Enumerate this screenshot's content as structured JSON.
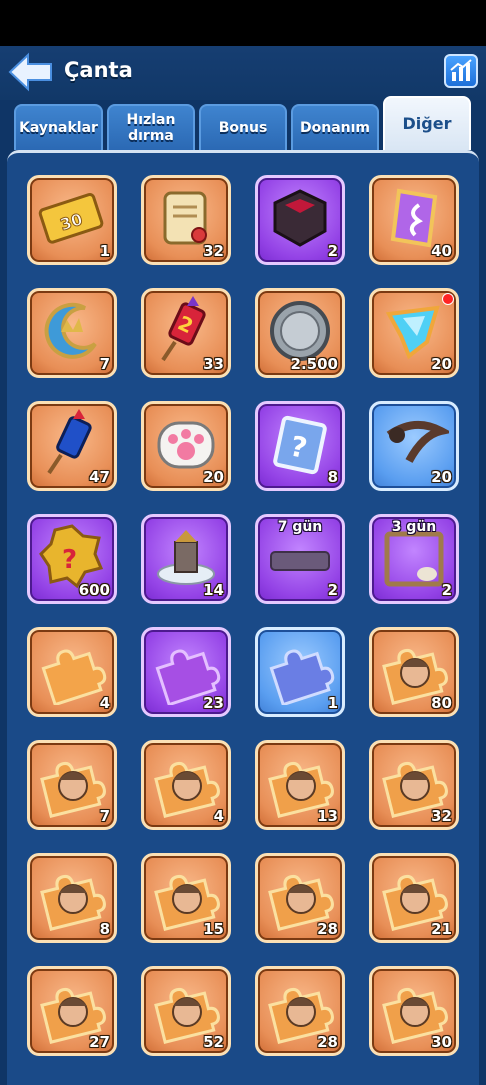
{
  "header": {
    "title": "Çanta"
  },
  "tabs": [
    {
      "label": "Kaynaklar",
      "active": false
    },
    {
      "label": "Hızlan dırma",
      "active": false
    },
    {
      "label": "Bonus",
      "active": false
    },
    {
      "label": "Donanım",
      "active": false
    },
    {
      "label": "Diğer",
      "active": true
    }
  ],
  "items": [
    {
      "icon": "ticket-30-icon",
      "count": "1",
      "bg": "orange"
    },
    {
      "icon": "scroll-icon",
      "count": "32",
      "bg": "orange"
    },
    {
      "icon": "dark-cube-icon",
      "count": "2",
      "bg": "purple"
    },
    {
      "icon": "purple-rune-icon",
      "count": "40",
      "bg": "orange"
    },
    {
      "icon": "crescent-moon-icon",
      "count": "7",
      "bg": "orange"
    },
    {
      "icon": "firework-2-icon",
      "count": "33",
      "bg": "orange"
    },
    {
      "icon": "silver-coin-icon",
      "count": "2.500",
      "bg": "orange"
    },
    {
      "icon": "blue-crystal-icon",
      "count": "20",
      "bg": "orange"
    },
    {
      "icon": "firework-blue-icon",
      "count": "47",
      "bg": "orange"
    },
    {
      "icon": "paw-icon",
      "count": "20",
      "bg": "orange"
    },
    {
      "icon": "mystery-card-icon",
      "count": "8",
      "bg": "purple"
    },
    {
      "icon": "scythe-icon",
      "count": "20",
      "bg": "blue"
    },
    {
      "icon": "mystery-badge-icon",
      "count": "600",
      "bg": "purple"
    },
    {
      "icon": "castle-skin-icon",
      "count": "14",
      "bg": "purple"
    },
    {
      "icon": "nameplate-icon",
      "count": "2",
      "bg": "purple",
      "days": "7 gün"
    },
    {
      "icon": "skull-frame-icon",
      "count": "2",
      "bg": "purple",
      "days": "3 gün"
    },
    {
      "icon": "orange-puzzle-icon",
      "count": "4",
      "bg": "orange"
    },
    {
      "icon": "purple-puzzle-icon",
      "count": "23",
      "bg": "purple"
    },
    {
      "icon": "blue-puzzle-icon",
      "count": "1",
      "bg": "blue"
    },
    {
      "icon": "hero-puzzle-icon",
      "count": "80",
      "bg": "orange"
    },
    {
      "icon": "hero-puzzle-icon",
      "count": "7",
      "bg": "orange"
    },
    {
      "icon": "hero-puzzle-icon",
      "count": "4",
      "bg": "orange"
    },
    {
      "icon": "hero-puzzle-icon",
      "count": "13",
      "bg": "orange"
    },
    {
      "icon": "hero-puzzle-icon",
      "count": "32",
      "bg": "orange"
    },
    {
      "icon": "hero-puzzle-icon",
      "count": "8",
      "bg": "orange"
    },
    {
      "icon": "hero-puzzle-icon",
      "count": "15",
      "bg": "orange"
    },
    {
      "icon": "hero-puzzle-icon",
      "count": "28",
      "bg": "orange"
    },
    {
      "icon": "hero-puzzle-icon",
      "count": "21",
      "bg": "orange"
    },
    {
      "icon": "hero-puzzle-icon",
      "count": "27",
      "bg": "orange"
    },
    {
      "icon": "hero-puzzle-icon",
      "count": "52",
      "bg": "orange"
    },
    {
      "icon": "hero-puzzle-icon",
      "count": "28",
      "bg": "orange"
    },
    {
      "icon": "hero-puzzle-icon",
      "count": "30",
      "bg": "orange"
    }
  ],
  "colors": {
    "background": "#0f3566",
    "panel": "#1a4a88",
    "slot_orange": "#e88f57",
    "slot_purple": "#9443e6",
    "slot_blue": "#5a9ef0"
  }
}
